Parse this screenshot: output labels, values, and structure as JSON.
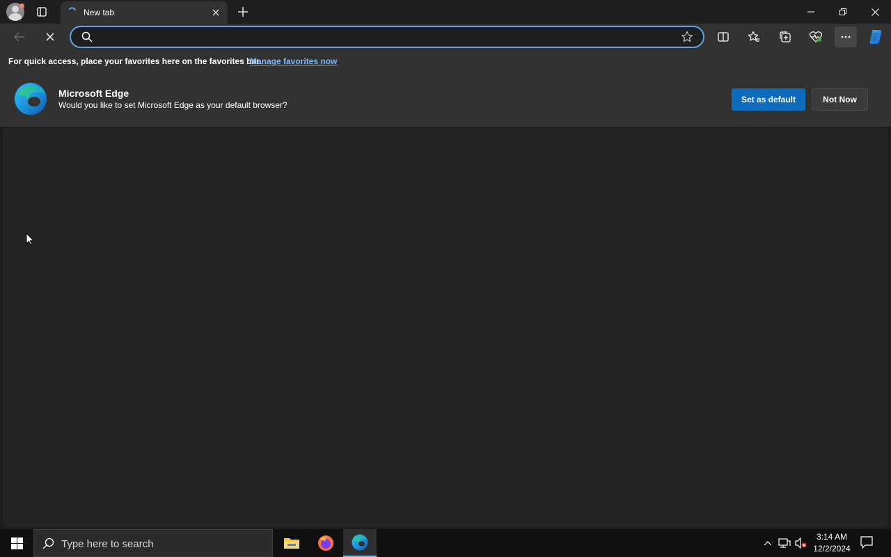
{
  "tab": {
    "title": "New tab"
  },
  "address": {
    "value": "",
    "placeholder": ""
  },
  "favorites_bar": {
    "message": "For quick access, place your favorites here on the favorites bar.",
    "link": "Manage favorites now"
  },
  "banner": {
    "title": "Microsoft Edge",
    "message": "Would you like to set Microsoft Edge as your default browser?",
    "primary_button": "Set as default",
    "secondary_button": "Not Now"
  },
  "taskbar": {
    "search_placeholder": "Type here to search",
    "time": "3:14 AM",
    "date": "12/2/2024",
    "apps": [
      "file-explorer",
      "firefox",
      "microsoft-edge"
    ]
  },
  "colors": {
    "accent": "#0f6cbd",
    "address_focus": "#5ea3ea",
    "link": "#7cb4f5"
  }
}
